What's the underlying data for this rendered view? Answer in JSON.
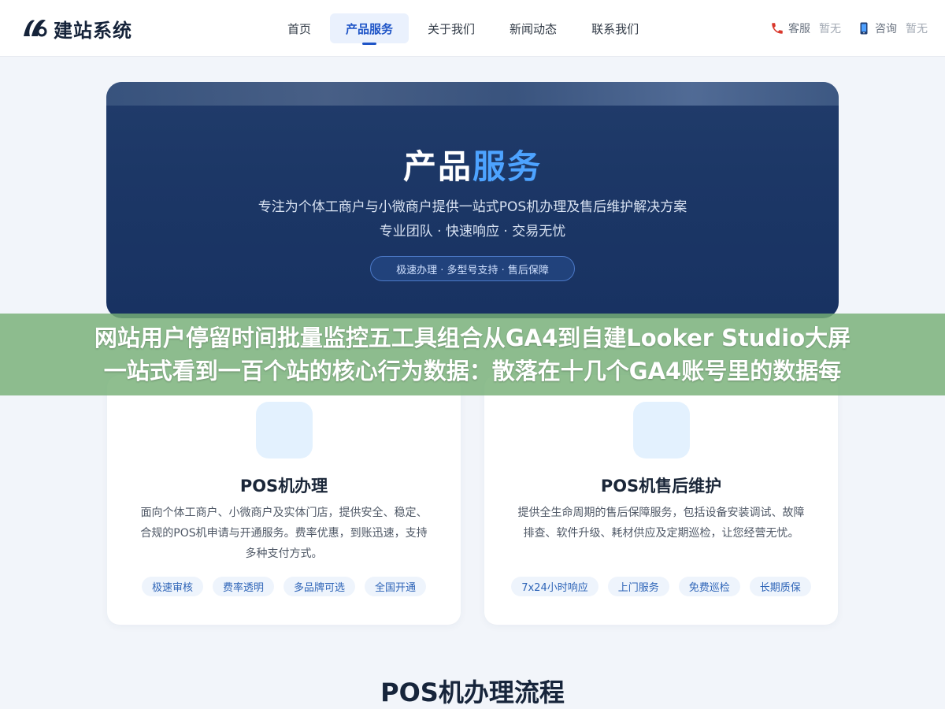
{
  "brand": {
    "name": "建站系统"
  },
  "nav": {
    "items": [
      {
        "label": "首页"
      },
      {
        "label": "产品服务"
      },
      {
        "label": "关于我们"
      },
      {
        "label": "新闻动态"
      },
      {
        "label": "联系我们"
      }
    ],
    "active_index": 1
  },
  "contacts": [
    {
      "icon": "phone-icon",
      "label": "客服",
      "value": "暂无"
    },
    {
      "icon": "mobile-icon",
      "label": "咨询",
      "value": "暂无"
    }
  ],
  "hero": {
    "title_main": "产品",
    "title_accent": "服务",
    "subtitle1": "专注为个体工商户与小微商户提供一站式POS机办理及售后维护解决方案",
    "subtitle2": "专业团队 · 快速响应 · 交易无忧",
    "pill": "极速办理 · 多型号支持 · 售后保障"
  },
  "overlay": {
    "line1": "网站用户停留时间批量监控五工具组合从GA4到自建Looker Studio大屏",
    "line2": "一站式看到一百个站的核心行为数据：散落在十几个GA4账号里的数据每"
  },
  "cards": [
    {
      "title": "POS机办理",
      "desc": "面向个体工商户、小微商户及实体门店，提供安全、稳定、合规的POS机申请与开通服务。费率优惠，到账迅速，支持多种支付方式。",
      "tags": [
        "极速审核",
        "费率透明",
        "多品牌可选",
        "全国开通"
      ]
    },
    {
      "title": "POS机售后维护",
      "desc": "提供全生命周期的售后保障服务，包括设备安装调试、故障排查、软件升级、耗材供应及定期巡检，让您经营无忧。",
      "tags": [
        "7x24小时响应",
        "上门服务",
        "免费巡检",
        "长期质保"
      ]
    }
  ],
  "section": {
    "title": "POS机办理流程"
  },
  "colors": {
    "accent": "#1f55c7",
    "hero_bg": "#1c3766",
    "highlight": "#4da3ff",
    "overlay": "#76b076"
  }
}
